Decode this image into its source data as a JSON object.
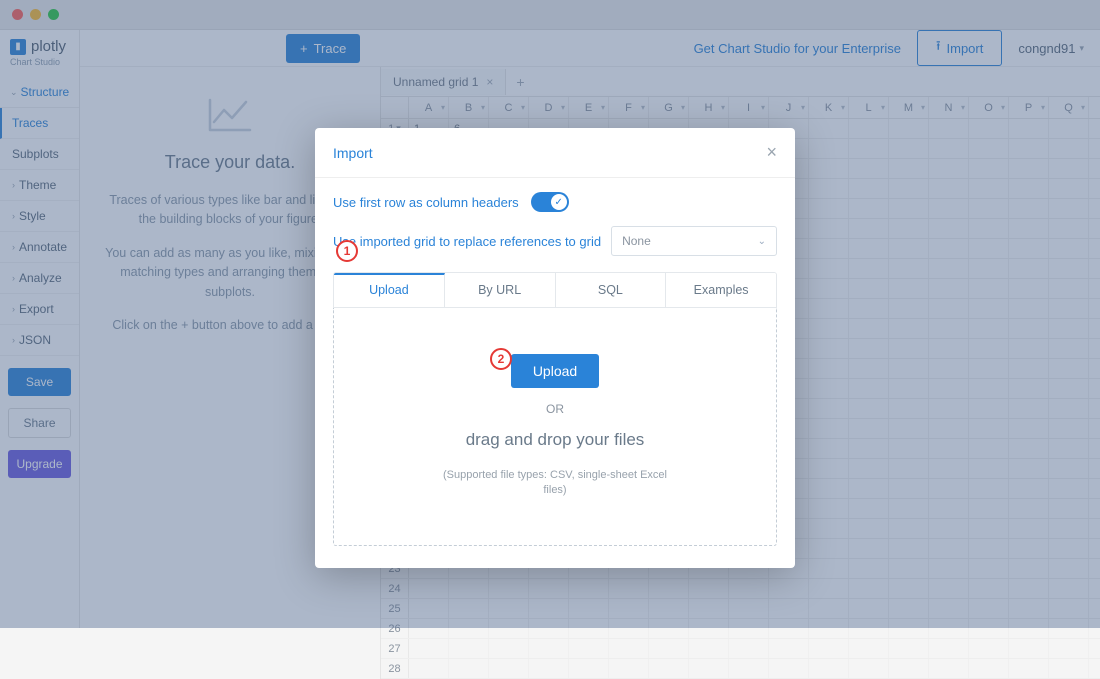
{
  "brand": {
    "name": "plotly",
    "sub": "Chart Studio"
  },
  "sidebar": {
    "section": "Structure",
    "items": [
      "Traces",
      "Subplots",
      "Theme",
      "Style",
      "Annotate",
      "Analyze",
      "Export",
      "JSON"
    ],
    "active_index": 0,
    "buttons": {
      "save": "Save",
      "share": "Share",
      "upgrade": "Upgrade"
    }
  },
  "topbar": {
    "trace": "Trace",
    "enterprise": "Get Chart Studio for your Enterprise",
    "import": "Import",
    "user": "congnd91"
  },
  "info": {
    "title": "Trace your data.",
    "p1": "Traces of various types like bar and line are the building blocks of your figure.",
    "p2": "You can add as many as you like, mixing and matching types and arranging them into subplots.",
    "p3": "Click on the + button above to add a trace."
  },
  "sheet": {
    "tab": "Unnamed grid 1",
    "cols": [
      "A",
      "B",
      "C",
      "D",
      "E",
      "F",
      "G",
      "H",
      "I",
      "J",
      "K",
      "L",
      "M",
      "N",
      "O",
      "P",
      "Q"
    ],
    "first_row": {
      "A": "1",
      "B": "6"
    },
    "visible_row_labels_bottom": [
      "26",
      "27",
      "28"
    ]
  },
  "modal": {
    "title": "Import",
    "opt1": "Use first row as column headers",
    "opt2": "Use imported grid to replace references to grid",
    "select_value": "None",
    "tabs": [
      "Upload",
      "By URL",
      "SQL",
      "Examples"
    ],
    "active_tab": 0,
    "upload_btn": "Upload",
    "or": "OR",
    "dnd": "drag and drop your files",
    "support": "(Supported file types: CSV, single-sheet Excel files)"
  },
  "annotations": {
    "a1": "1",
    "a2": "2"
  }
}
